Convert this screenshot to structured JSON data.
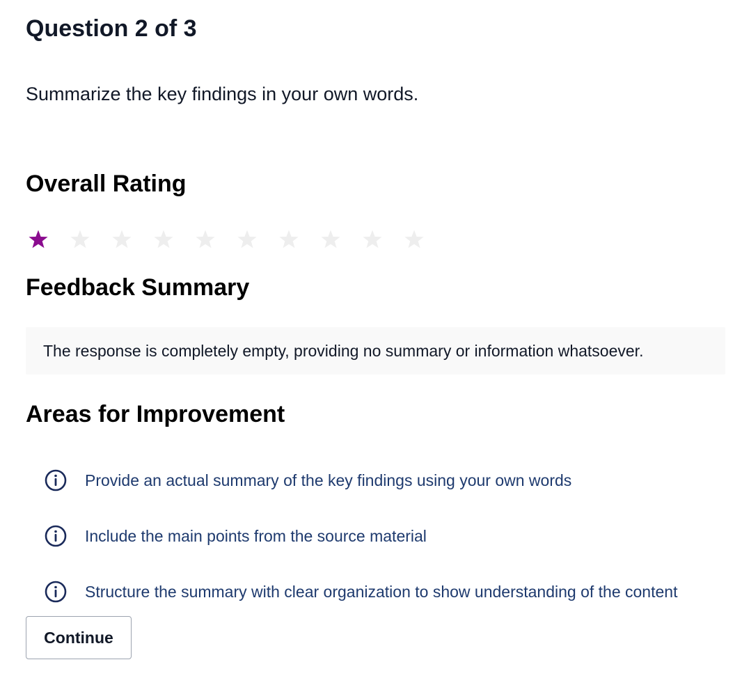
{
  "question": {
    "title": "Question 2 of 3",
    "prompt": "Summarize the key findings in your own words."
  },
  "rating": {
    "heading": "Overall Rating",
    "value": 1,
    "max": 10,
    "filled_color": "#8b0c8f",
    "empty_color": "#eeeeee",
    "icon": "star-icon"
  },
  "feedback": {
    "heading": "Feedback Summary",
    "text": "The response is completely empty, providing no summary or information whatsoever."
  },
  "improvements": {
    "heading": "Areas for Improvement",
    "icon": "info-circle-icon",
    "icon_color": "#1a2a5a",
    "items": [
      "Provide an actual summary of the key findings using your own words",
      "Include the main points from the source material",
      "Structure the summary with clear organization to show understanding of the content"
    ]
  },
  "actions": {
    "continue_label": "Continue"
  }
}
